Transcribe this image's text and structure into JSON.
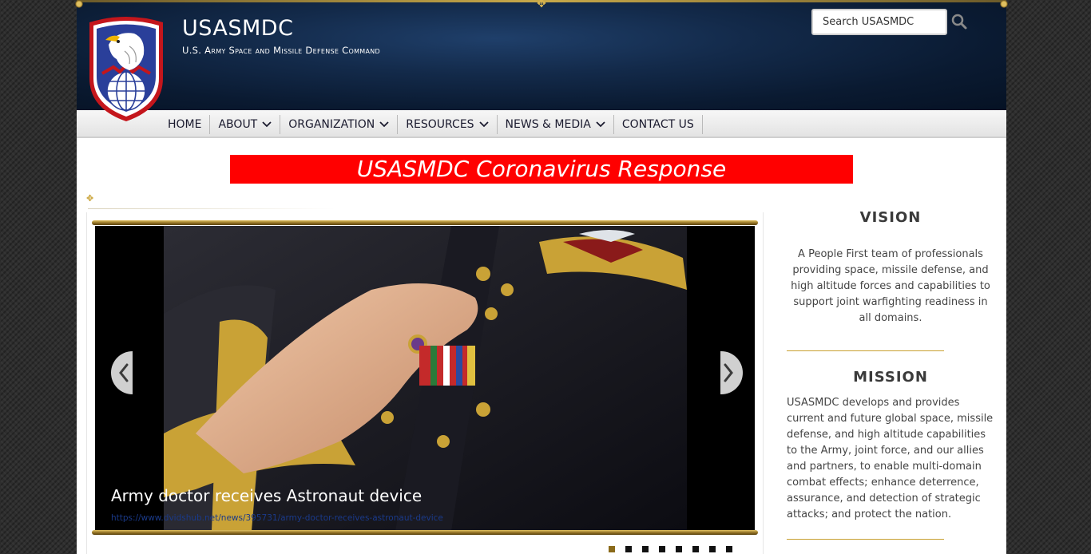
{
  "header": {
    "site_title": "USASMDC",
    "site_subtitle": "U.S. Army Space and Missile Defense Command",
    "logo_icon": "eagle-globe-shield-icon"
  },
  "search": {
    "placeholder": "Search USASMDC",
    "value": "Search USASMDC",
    "button_icon": "search-icon"
  },
  "nav": {
    "items": [
      {
        "label": "HOME",
        "dropdown": false
      },
      {
        "label": "ABOUT",
        "dropdown": true
      },
      {
        "label": "ORGANIZATION",
        "dropdown": true
      },
      {
        "label": "RESOURCES",
        "dropdown": true
      },
      {
        "label": "NEWS & MEDIA",
        "dropdown": true
      },
      {
        "label": "CONTACT US",
        "dropdown": false
      }
    ]
  },
  "banner": {
    "label": "USASMDC Coronavirus Response",
    "color": "#ff0000"
  },
  "slider": {
    "caption": "Army doctor receives Astronaut device",
    "link": "https://www.dvidshub.net/news/395731/army-doctor-receives-astronaut-device",
    "prev_icon": "chevron-left-icon",
    "next_icon": "chevron-right-icon",
    "dot_count": 8,
    "active_dot": 1
  },
  "vision": {
    "heading": "VISION",
    "text": "A People First team of professionals providing space, missile defense, and high altitude forces and capabilities to support joint warfighting readiness in all domains."
  },
  "mission": {
    "heading": "MISSION",
    "text": "USASMDC develops and provides current and future global space, missile defense, and high altitude capabilities to the Army, joint force, and our allies and partners, to enable multi-domain combat effects; enhance deterrence, assurance, and detection of strategic attacks; and protect the nation."
  },
  "colors": {
    "accent_gold": "#c8a030",
    "header_navy": "#0f2646",
    "banner_red": "#ff0000"
  }
}
